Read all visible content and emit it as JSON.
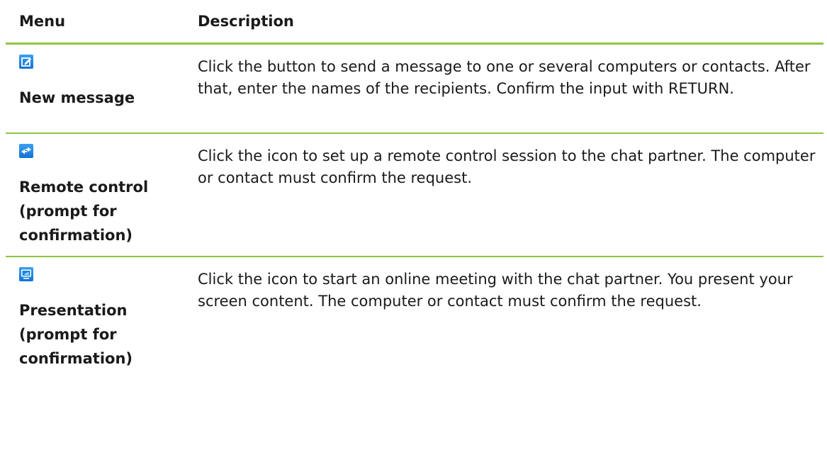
{
  "header": {
    "menu_label": "Menu",
    "description_label": "Description"
  },
  "rows": [
    {
      "icon": "new-message-icon",
      "title": "New message",
      "description": "Click the button to send a message to one or several computers or contacts. After that, enter the names of the recipients. Confirm the input with RETURN."
    },
    {
      "icon": "remote-control-icon",
      "title": "Remote control (prompt for confirmation)",
      "description": "Click the icon to set up a remote control session to the chat partner. The computer or contact must confirm the request."
    },
    {
      "icon": "presentation-icon",
      "title": "Presentation (prompt for confirmation)",
      "description": "Click the icon to start an online meeting with the chat partner. You present your screen content. The computer or contact must confirm the request."
    }
  ],
  "colors": {
    "rule": "#8dc63f",
    "icon_blue": "#1a86e0"
  }
}
